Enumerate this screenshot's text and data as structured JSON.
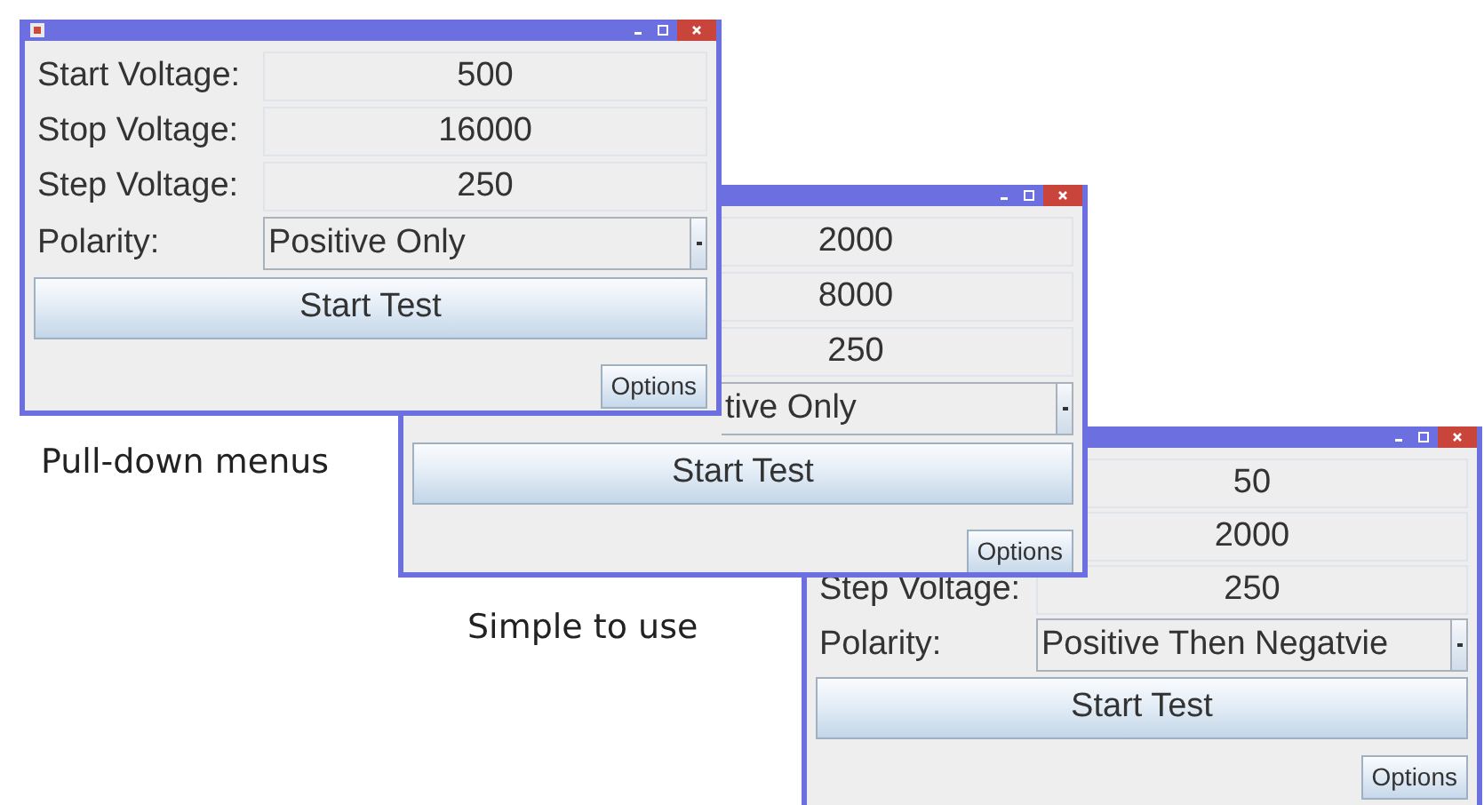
{
  "windows": [
    {
      "app_icon": true,
      "rows": [
        {
          "label": "Start Voltage:",
          "value": "500"
        },
        {
          "label": "Stop Voltage:",
          "value": "16000"
        },
        {
          "label": "Step Voltage:",
          "value": "250"
        }
      ],
      "polarity": {
        "label": "Polarity:",
        "value": "Positive Only"
      },
      "start_button": "Start Test",
      "options_button": "Options"
    },
    {
      "app_icon": false,
      "rows": [
        {
          "value": "2000"
        },
        {
          "value": "8000"
        },
        {
          "value": "250"
        }
      ],
      "polarity": {
        "value": "tive Only"
      },
      "start_button": "Start Test",
      "options_button": "Options"
    },
    {
      "app_icon": false,
      "rows": [
        {
          "value": "50"
        },
        {
          "value": "2000"
        },
        {
          "label": "Step Voltage:",
          "value": "250"
        }
      ],
      "polarity": {
        "label": "Polarity:",
        "value": "Positive Then Negatvie"
      },
      "start_button": "Start Test",
      "options_button": "Options"
    }
  ],
  "captions": [
    "Pull-down menus",
    "Simple to use"
  ]
}
